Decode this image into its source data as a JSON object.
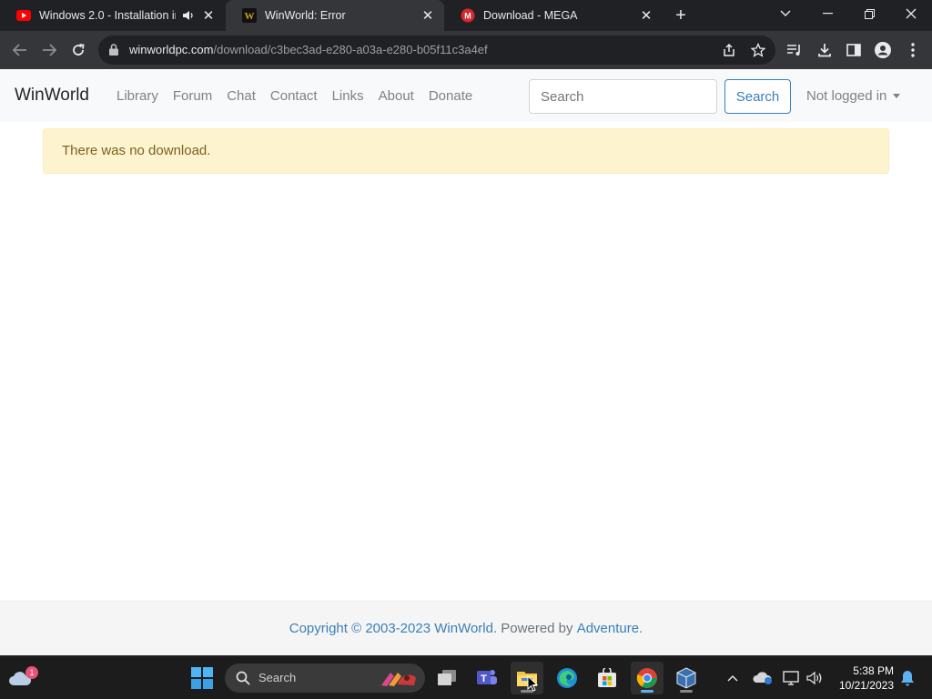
{
  "browser": {
    "tabs": [
      {
        "title": "Windows 2.0 - Installation in",
        "favicon": "youtube-icon",
        "active": false
      },
      {
        "title": "WinWorld: Error",
        "favicon": "winworld-icon",
        "active": true
      },
      {
        "title": "Download - MEGA",
        "favicon": "mega-icon",
        "active": false
      }
    ],
    "address": {
      "host": "winworldpc.com",
      "path": "/download/c3bec3ad-e280-a03a-e280-b05f11c3a4ef"
    }
  },
  "site": {
    "brand": "WinWorld",
    "nav": [
      "Library",
      "Forum",
      "Chat",
      "Contact",
      "Links",
      "About",
      "Donate"
    ],
    "search_placeholder": "Search",
    "search_button": "Search",
    "login": "Not logged in"
  },
  "alert": {
    "message": "There was no download."
  },
  "footer": {
    "copyright": "Copyright © 2003-2023",
    "site_link": "WinWorld",
    "powered_prefix": ". Powered by",
    "powered_link": "Adventure",
    "end": "."
  },
  "taskbar": {
    "search_label": "Search",
    "weather_badge": "1",
    "time": "5:38 PM",
    "date": "10/21/2023"
  },
  "colors": {
    "alert_bg": "#fdf3cf",
    "alert_text": "#7a6220",
    "link": "#3a7fb8",
    "chrome_dark": "#202124"
  }
}
